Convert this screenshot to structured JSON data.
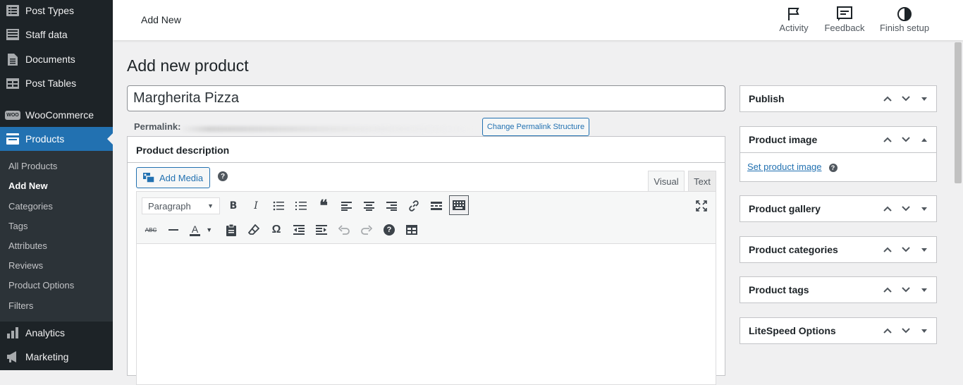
{
  "sidebar": {
    "items": [
      {
        "label": "Post Types",
        "icon": "list-icon"
      },
      {
        "label": "Staff data",
        "icon": "table-icon"
      },
      {
        "label": "Documents",
        "icon": "document-icon"
      },
      {
        "label": "Post Tables",
        "icon": "grid-table-icon"
      },
      {
        "label": "WooCommerce",
        "icon": "woo-icon",
        "icon_text": "WOO"
      },
      {
        "label": "Products",
        "icon": "archive-icon"
      },
      {
        "label": "Analytics",
        "icon": "bar-chart-icon"
      },
      {
        "label": "Marketing",
        "icon": "megaphone-icon"
      }
    ],
    "submenu": [
      "All Products",
      "Add New",
      "Categories",
      "Tags",
      "Attributes",
      "Reviews",
      "Product Options",
      "Filters"
    ],
    "current_submenu": "Add New",
    "active_color": "#2271b1"
  },
  "topbar": {
    "title": "Add New",
    "actions": [
      {
        "label": "Activity",
        "icon": "flag-icon"
      },
      {
        "label": "Feedback",
        "icon": "feedback-icon"
      },
      {
        "label": "Finish setup",
        "icon": "half-circle-icon"
      }
    ]
  },
  "page": {
    "heading": "Add new product",
    "title_value": "Margherita Pizza",
    "permalink_label": "Permalink:",
    "permalink_button": "Change Permalink Structure"
  },
  "editor": {
    "header": "Product description",
    "add_media": "Add Media",
    "help": "?",
    "tabs": [
      "Visual",
      "Text"
    ],
    "active_tab": "Visual",
    "format_value": "Paragraph"
  },
  "metaboxes": [
    {
      "title": "Publish"
    },
    {
      "title": "Product image",
      "link": "Set product image",
      "help": "?"
    },
    {
      "title": "Product gallery"
    },
    {
      "title": "Product categories"
    },
    {
      "title": "Product tags"
    },
    {
      "title": "LiteSpeed Options"
    }
  ]
}
